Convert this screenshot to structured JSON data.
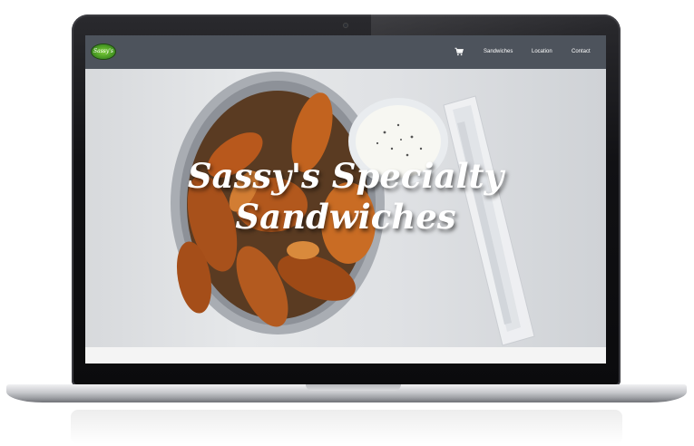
{
  "site": {
    "logo_text": "Sassy's",
    "hero_title": "Sassy's Specialty Sandwiches"
  },
  "nav": {
    "cart_icon": "shopping-cart-icon",
    "items": [
      {
        "label": "Sandwiches"
      },
      {
        "label": "Location"
      },
      {
        "label": "Contact"
      }
    ]
  },
  "colors": {
    "navbar": "#4d535c",
    "logo_green": "#5cb82a",
    "hero_text": "#ffffff"
  }
}
